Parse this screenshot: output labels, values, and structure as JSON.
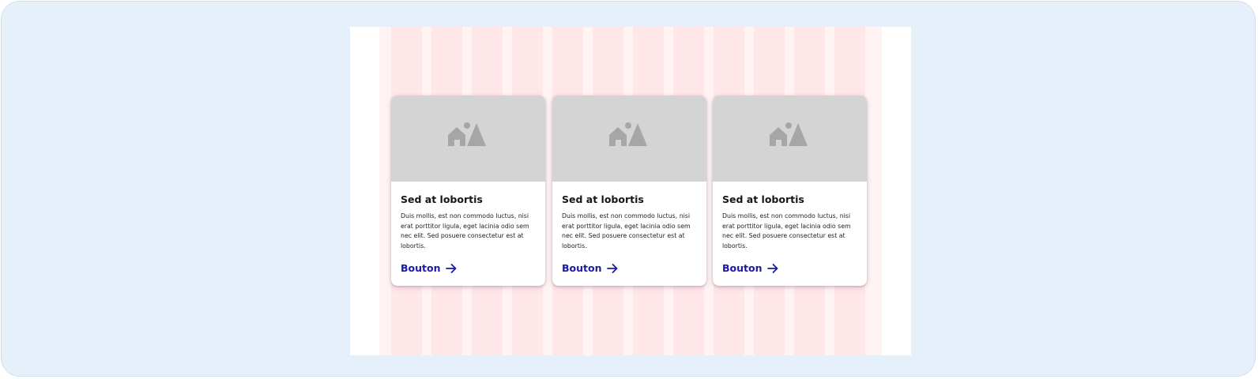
{
  "cards": [
    {
      "title": "Sed at lobortis",
      "text": "Duis mollis, est non commodo luctus, nisi erat porttitor ligula, eget lacinia odio sem nec elit. Sed posuere consectetur est at lobortis.",
      "button_label": "Bouton",
      "image_icon": "image-placeholder-icon",
      "arrow_icon": "arrow-right-icon"
    },
    {
      "title": "Sed at lobortis",
      "text": "Duis mollis, est non commodo luctus, nisi erat porttitor ligula, eget lacinia odio sem nec elit. Sed posuere consectetur est at lobortis.",
      "button_label": "Bouton",
      "image_icon": "image-placeholder-icon",
      "arrow_icon": "arrow-right-icon"
    },
    {
      "title": "Sed at lobortis",
      "text": "Duis mollis, est non commodo luctus, nisi erat porttitor ligula, eget lacinia odio sem nec elit. Sed posuere consectetur est at lobortis.",
      "button_label": "Bouton",
      "image_icon": "image-placeholder-icon",
      "arrow_icon": "arrow-right-icon"
    }
  ],
  "colors": {
    "frame_background": "#e6f0fb",
    "grid_column": "#ffe6e8",
    "grid_gutter": "#fff3f3",
    "image_placeholder": "#d4d4d4",
    "placeholder_icon": "#a6a6a6",
    "link": "#1a1aa6"
  }
}
